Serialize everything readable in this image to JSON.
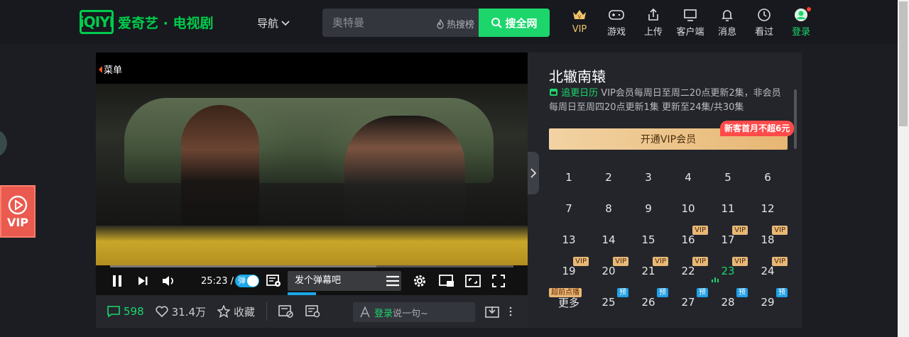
{
  "header": {
    "logo_mark": "iQIYI",
    "logo_text": "爱奇艺 · 电视剧",
    "nav_label": "导航",
    "search_placeholder": "奥特曼",
    "hot_list_label": "热搜榜",
    "search_button": "搜全网",
    "icons": [
      {
        "name": "vip",
        "label": "VIP"
      },
      {
        "name": "game",
        "label": "游戏"
      },
      {
        "name": "upload",
        "label": "上传"
      },
      {
        "name": "client",
        "label": "客户端"
      },
      {
        "name": "message",
        "label": "消息"
      },
      {
        "name": "history",
        "label": "看过"
      },
      {
        "name": "login",
        "label": "登录"
      }
    ]
  },
  "floating": {
    "vip_label": "VIP"
  },
  "player": {
    "menu_label": "菜单",
    "time_current": "25:23 /",
    "danmu_toggle": "弹",
    "danmu_input": "发个弹幕吧",
    "progress_fraction": 0.66
  },
  "below": {
    "comments": "598",
    "likes": "31.4万",
    "collect": "收藏",
    "comment_login": "登录",
    "comment_placeholder": "说一句~"
  },
  "panel": {
    "title": "北辙南辕",
    "calendar_label": "追更日历",
    "update_text": "VIP会员每周日至周二20点更新2集，非会员每周日至周四20点更新1集 更新至24集/共30集",
    "vip_button": "开通VIP会员",
    "vip_badge": "新客首月不超6元",
    "episodes": [
      {
        "n": "1",
        "tag": ""
      },
      {
        "n": "2",
        "tag": ""
      },
      {
        "n": "3",
        "tag": ""
      },
      {
        "n": "4",
        "tag": ""
      },
      {
        "n": "5",
        "tag": ""
      },
      {
        "n": "6",
        "tag": ""
      },
      {
        "n": "7",
        "tag": ""
      },
      {
        "n": "8",
        "tag": ""
      },
      {
        "n": "9",
        "tag": ""
      },
      {
        "n": "10",
        "tag": ""
      },
      {
        "n": "11",
        "tag": ""
      },
      {
        "n": "12",
        "tag": ""
      },
      {
        "n": "13",
        "tag": ""
      },
      {
        "n": "14",
        "tag": ""
      },
      {
        "n": "15",
        "tag": ""
      },
      {
        "n": "16",
        "tag": "VIP"
      },
      {
        "n": "17",
        "tag": "VIP"
      },
      {
        "n": "18",
        "tag": "VIP"
      },
      {
        "n": "19",
        "tag": "VIP"
      },
      {
        "n": "20",
        "tag": "VIP"
      },
      {
        "n": "21",
        "tag": "VIP"
      },
      {
        "n": "22",
        "tag": "VIP"
      },
      {
        "n": "23",
        "tag": "VIP",
        "active": true
      },
      {
        "n": "24",
        "tag": "VIP"
      },
      {
        "n": "更多",
        "tag": "超前点播",
        "early": true
      },
      {
        "n": "25",
        "tag": "预",
        "pre": true
      },
      {
        "n": "26",
        "tag": "预",
        "pre": true
      },
      {
        "n": "27",
        "tag": "预",
        "pre": true
      },
      {
        "n": "28",
        "tag": "预",
        "pre": true
      },
      {
        "n": "29",
        "tag": "预",
        "pre": true
      }
    ]
  }
}
